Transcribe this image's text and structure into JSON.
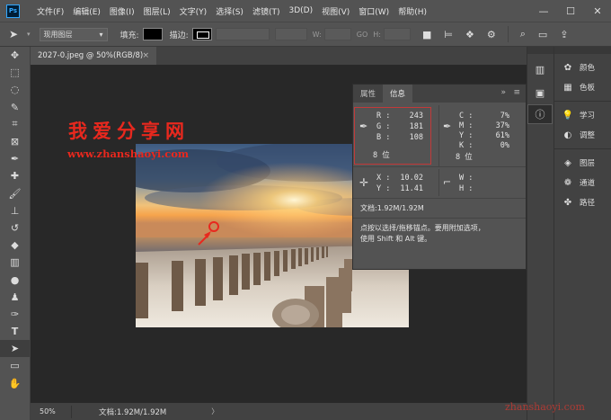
{
  "menubar": {
    "logo": "Ps",
    "items": [
      "文件(F)",
      "编辑(E)",
      "图像(I)",
      "图层(L)",
      "文字(Y)",
      "选择(S)",
      "滤镜(T)",
      "3D(D)",
      "视图(V)",
      "窗口(W)",
      "帮助(H)"
    ],
    "minimize": "—",
    "maximize": "☐",
    "close": "✕"
  },
  "options": {
    "mode_select": "现用图层",
    "fill_label": "填充:",
    "stroke_label": "描边:",
    "w_label": "W:",
    "h_label": "H:",
    "link": "GO"
  },
  "document": {
    "tab_title": "2027-0.jpeg @ 50%(RGB/8)",
    "tab_close": "×"
  },
  "watermark": {
    "title": "我爱分享网",
    "url": "www.zhanshaoyi.com",
    "footer": "zhanshaoyi.com"
  },
  "info_panel": {
    "tabs": [
      "属性",
      "信息"
    ],
    "active_tab": 1,
    "collapse": "»",
    "rgb": {
      "r_label": "R :",
      "g_label": "G :",
      "b_label": "B :",
      "r": "243",
      "g": "181",
      "b": "108",
      "bits": "8 位"
    },
    "cmyk": {
      "c_label": "C :",
      "m_label": "M :",
      "y_label": "Y :",
      "k_label": "K :",
      "c": "7%",
      "m": "37%",
      "y": "61%",
      "k": "0%",
      "bits": "8 位"
    },
    "xy": {
      "x_label": "X :",
      "y_label": "Y :",
      "x": "10.02",
      "y": "11.41"
    },
    "wh": {
      "w_label": "W :",
      "h_label": "H :"
    },
    "doc_size": "文档:1.92M/1.92M",
    "hint_line1": "点按以选择/拖移锚点。要用附加选项，",
    "hint_line2": "使用 Shift 和 Alt 键。"
  },
  "right_panels": {
    "group1": [
      {
        "icon": "palette-icon",
        "label": "颜色"
      },
      {
        "icon": "swatches-icon",
        "label": "色板"
      }
    ],
    "group2": [
      {
        "icon": "lightbulb-icon",
        "label": "学习"
      },
      {
        "icon": "adjust-icon",
        "label": "调整"
      }
    ],
    "group3": [
      {
        "icon": "layers-icon",
        "label": "图层"
      },
      {
        "icon": "channels-icon",
        "label": "通道"
      },
      {
        "icon": "paths-icon",
        "label": "路径"
      }
    ]
  },
  "status": {
    "zoom": "50%",
    "doc_size": "文档:1.92M/1.92M",
    "arrow": "〉"
  }
}
